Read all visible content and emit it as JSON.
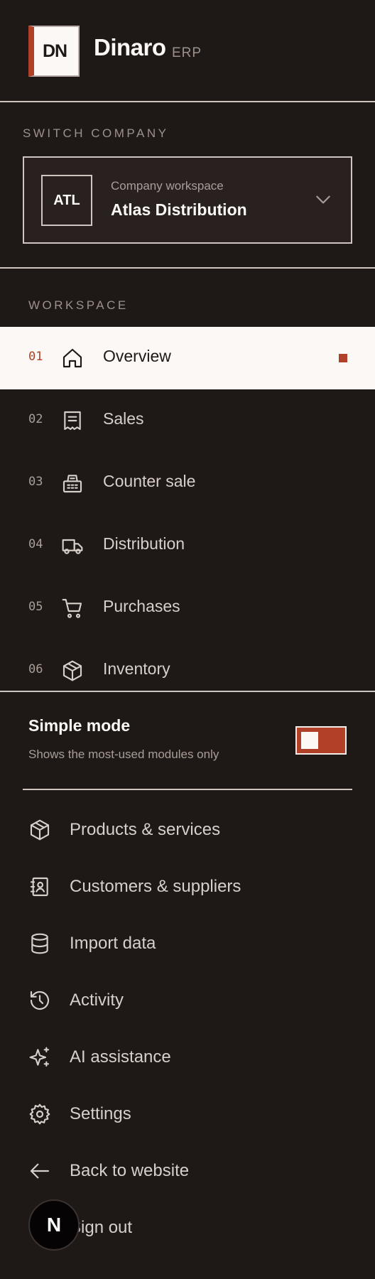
{
  "brand": {
    "initials": "DN",
    "name": "Dinaro",
    "suffix": "ERP",
    "accent": "#b04128"
  },
  "company_switcher": {
    "section_label": "SWITCH COMPANY",
    "avatar": "ATL",
    "caption": "Company workspace",
    "name": "Atlas Distribution",
    "icon": "chevron-down-icon"
  },
  "workspace": {
    "section_label": "WORKSPACE",
    "items": [
      {
        "num": "01",
        "label": "Overview",
        "icon": "home-icon",
        "active": true
      },
      {
        "num": "02",
        "label": "Sales",
        "icon": "receipt-icon",
        "active": false
      },
      {
        "num": "03",
        "label": "Counter sale",
        "icon": "cash-register-icon",
        "active": false
      },
      {
        "num": "04",
        "label": "Distribution",
        "icon": "truck-icon",
        "active": false
      },
      {
        "num": "05",
        "label": "Purchases",
        "icon": "cart-icon",
        "active": false
      },
      {
        "num": "06",
        "label": "Inventory",
        "icon": "package-icon",
        "active": false
      }
    ]
  },
  "simple_mode": {
    "title": "Simple mode",
    "description": "Shows the most-used modules only",
    "enabled": true
  },
  "tools": [
    {
      "label": "Products & services",
      "icon": "package-icon"
    },
    {
      "label": "Customers & suppliers",
      "icon": "contact-book-icon"
    },
    {
      "label": "Import data",
      "icon": "database-icon"
    },
    {
      "label": "Activity",
      "icon": "history-icon"
    },
    {
      "label": "AI assistance",
      "icon": "sparkles-icon"
    },
    {
      "label": "Settings",
      "icon": "gear-icon"
    },
    {
      "label": "Back to website",
      "icon": "arrow-left-icon"
    },
    {
      "label": "Sign out",
      "icon": "sign-out-icon"
    }
  ],
  "fab": {
    "label": "N"
  }
}
